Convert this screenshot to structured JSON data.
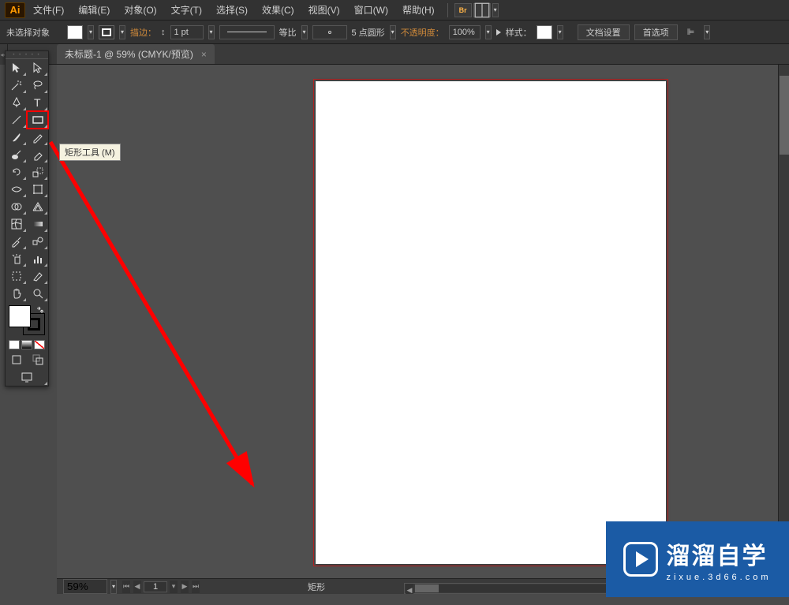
{
  "app": {
    "logo_text": "Ai"
  },
  "menu": {
    "file": "文件(F)",
    "edit": "编辑(E)",
    "object": "对象(O)",
    "type": "文字(T)",
    "select": "选择(S)",
    "effect": "效果(C)",
    "view": "视图(V)",
    "window": "窗口(W)",
    "help": "帮助(H)"
  },
  "menu_icons": {
    "br": "Br"
  },
  "control": {
    "no_selection": "未选择对象",
    "stroke_label": "描边：",
    "stroke_weight": "1 pt",
    "uniform": "等比",
    "brush_def": "5 点圆形",
    "opacity_label": "不透明度：",
    "opacity_value": "100%",
    "style_label": "样式：",
    "doc_setup_btn": "文档设置",
    "prefs_btn": "首选项"
  },
  "tab": {
    "title": "未标题-1 @ 59% (CMYK/预览)",
    "close": "×"
  },
  "tooltip": {
    "rectangle": "矩形工具 (M)"
  },
  "status": {
    "zoom_value": "59%",
    "page_value": "1",
    "tool_label": "矩形"
  },
  "watermark": {
    "big": "溜溜自学",
    "sub": "zixue.3d66.com"
  },
  "nav_arrows": {
    "first": "⏮",
    "prev": "◀",
    "next": "▶",
    "last": "⏭",
    "dropdown": "▾"
  }
}
